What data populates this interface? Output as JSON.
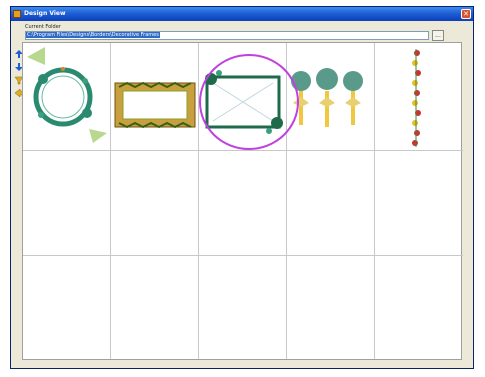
{
  "window": {
    "title": "Design View",
    "close_glyph": "✕"
  },
  "path": {
    "label": "Current Folder",
    "value": "C:\\Program Files\\Designs\\Borders\\Decorative Frames"
  },
  "browse_label": "...",
  "toolbar": {
    "tools": [
      "up-arrow-icon",
      "down-arrow-icon",
      "filter-icon",
      "back-icon"
    ]
  },
  "thumbnails": [
    {
      "name": "floral-wreath-thumbnail"
    },
    {
      "name": "gold-border-thumbnail"
    },
    {
      "name": "vine-frame-thumbnail"
    },
    {
      "name": "palm-trees-thumbnail"
    },
    {
      "name": "flower-strip-thumbnail"
    }
  ],
  "colors": {
    "accent": "#1f5fd6",
    "highlight": "#c040e0"
  }
}
